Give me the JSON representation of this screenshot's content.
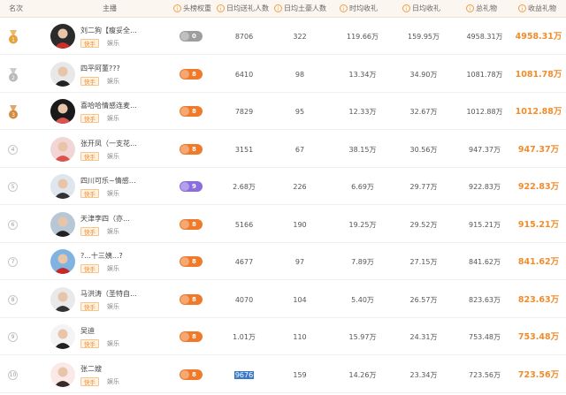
{
  "header": {
    "rank": "名次",
    "anchor": "主播",
    "weight": "头榜权重",
    "gift_users": "日均送礼人数",
    "fans": "日均土豪人数",
    "sample": "时均收礼",
    "income": "日均收礼",
    "total": "总礼物",
    "profit": "收益礼物",
    "info_icon": "i"
  },
  "colors": {
    "accent": "#f08c2a",
    "weight_gray": "#9e9e9e",
    "weight_orange": "#f07a2a",
    "weight_purple": "#8a6ee0",
    "gold": "#e6a23a",
    "silver": "#b9b9b9",
    "bronze": "#d48a3c"
  },
  "rows": [
    {
      "rank": "1",
      "medal": "gold",
      "name": "刘二狗【瘦妥全…",
      "platform": "快手",
      "category": "娱乐",
      "weight": "0",
      "weight_color": "gray",
      "gift_users": "8706",
      "fans": "322",
      "sample": "119.66万",
      "income": "159.95万",
      "total": "4958.31万",
      "profit": "4958.31万"
    },
    {
      "rank": "2",
      "medal": "silver",
      "name": "四平阿董???",
      "platform": "快手",
      "category": "娱乐",
      "weight": "8",
      "weight_color": "orange",
      "gift_users": "6410",
      "fans": "98",
      "sample": "13.34万",
      "income": "34.90万",
      "total": "1081.78万",
      "profit": "1081.78万"
    },
    {
      "rank": "3",
      "medal": "bronze",
      "name": "喜哈哈情感连麦…",
      "platform": "快手",
      "category": "娱乐",
      "weight": "8",
      "weight_color": "orange",
      "gift_users": "7829",
      "fans": "95",
      "sample": "12.33万",
      "income": "32.67万",
      "total": "1012.88万",
      "profit": "1012.88万"
    },
    {
      "rank": "4",
      "medal": "",
      "name": "张开凤（一支花…",
      "platform": "快手",
      "category": "娱乐",
      "weight": "8",
      "weight_color": "orange",
      "gift_users": "3151",
      "fans": "67",
      "sample": "38.15万",
      "income": "30.56万",
      "total": "947.37万",
      "profit": "947.37万"
    },
    {
      "rank": "5",
      "medal": "",
      "name": "四川可乐~情感…",
      "platform": "快手",
      "category": "娱乐",
      "weight": "9",
      "weight_color": "purple",
      "gift_users": "2.68万",
      "fans": "226",
      "sample": "6.69万",
      "income": "29.77万",
      "total": "922.83万",
      "profit": "922.83万"
    },
    {
      "rank": "6",
      "medal": "",
      "name": "天津李四（亦…",
      "platform": "快手",
      "category": "娱乐",
      "weight": "8",
      "weight_color": "orange",
      "gift_users": "5166",
      "fans": "190",
      "sample": "19.25万",
      "income": "29.52万",
      "total": "915.21万",
      "profit": "915.21万"
    },
    {
      "rank": "7",
      "medal": "",
      "name": "?...十三姨...?",
      "platform": "快手",
      "category": "娱乐",
      "weight": "8",
      "weight_color": "orange",
      "gift_users": "4677",
      "fans": "97",
      "sample": "7.89万",
      "income": "27.15万",
      "total": "841.62万",
      "profit": "841.62万"
    },
    {
      "rank": "8",
      "medal": "",
      "name": "马洪涛（圣特自…",
      "platform": "快手",
      "category": "娱乐",
      "weight": "8",
      "weight_color": "orange",
      "gift_users": "4070",
      "fans": "104",
      "sample": "5.40万",
      "income": "26.57万",
      "total": "823.63万",
      "profit": "823.63万"
    },
    {
      "rank": "9",
      "medal": "",
      "name": "吴迪",
      "platform": "快手",
      "category": "娱乐",
      "weight": "8",
      "weight_color": "orange",
      "gift_users": "1.01万",
      "fans": "110",
      "sample": "15.97万",
      "income": "24.31万",
      "total": "753.48万",
      "profit": "753.48万"
    },
    {
      "rank": "10",
      "medal": "",
      "name": "张二嫂",
      "platform": "快手",
      "category": "娱乐",
      "weight": "8",
      "weight_color": "orange",
      "gift_users": "9676",
      "fans": "159",
      "sample": "14.26万",
      "income": "23.34万",
      "total": "723.56万",
      "profit": "723.56万",
      "gift_selected": true
    }
  ]
}
